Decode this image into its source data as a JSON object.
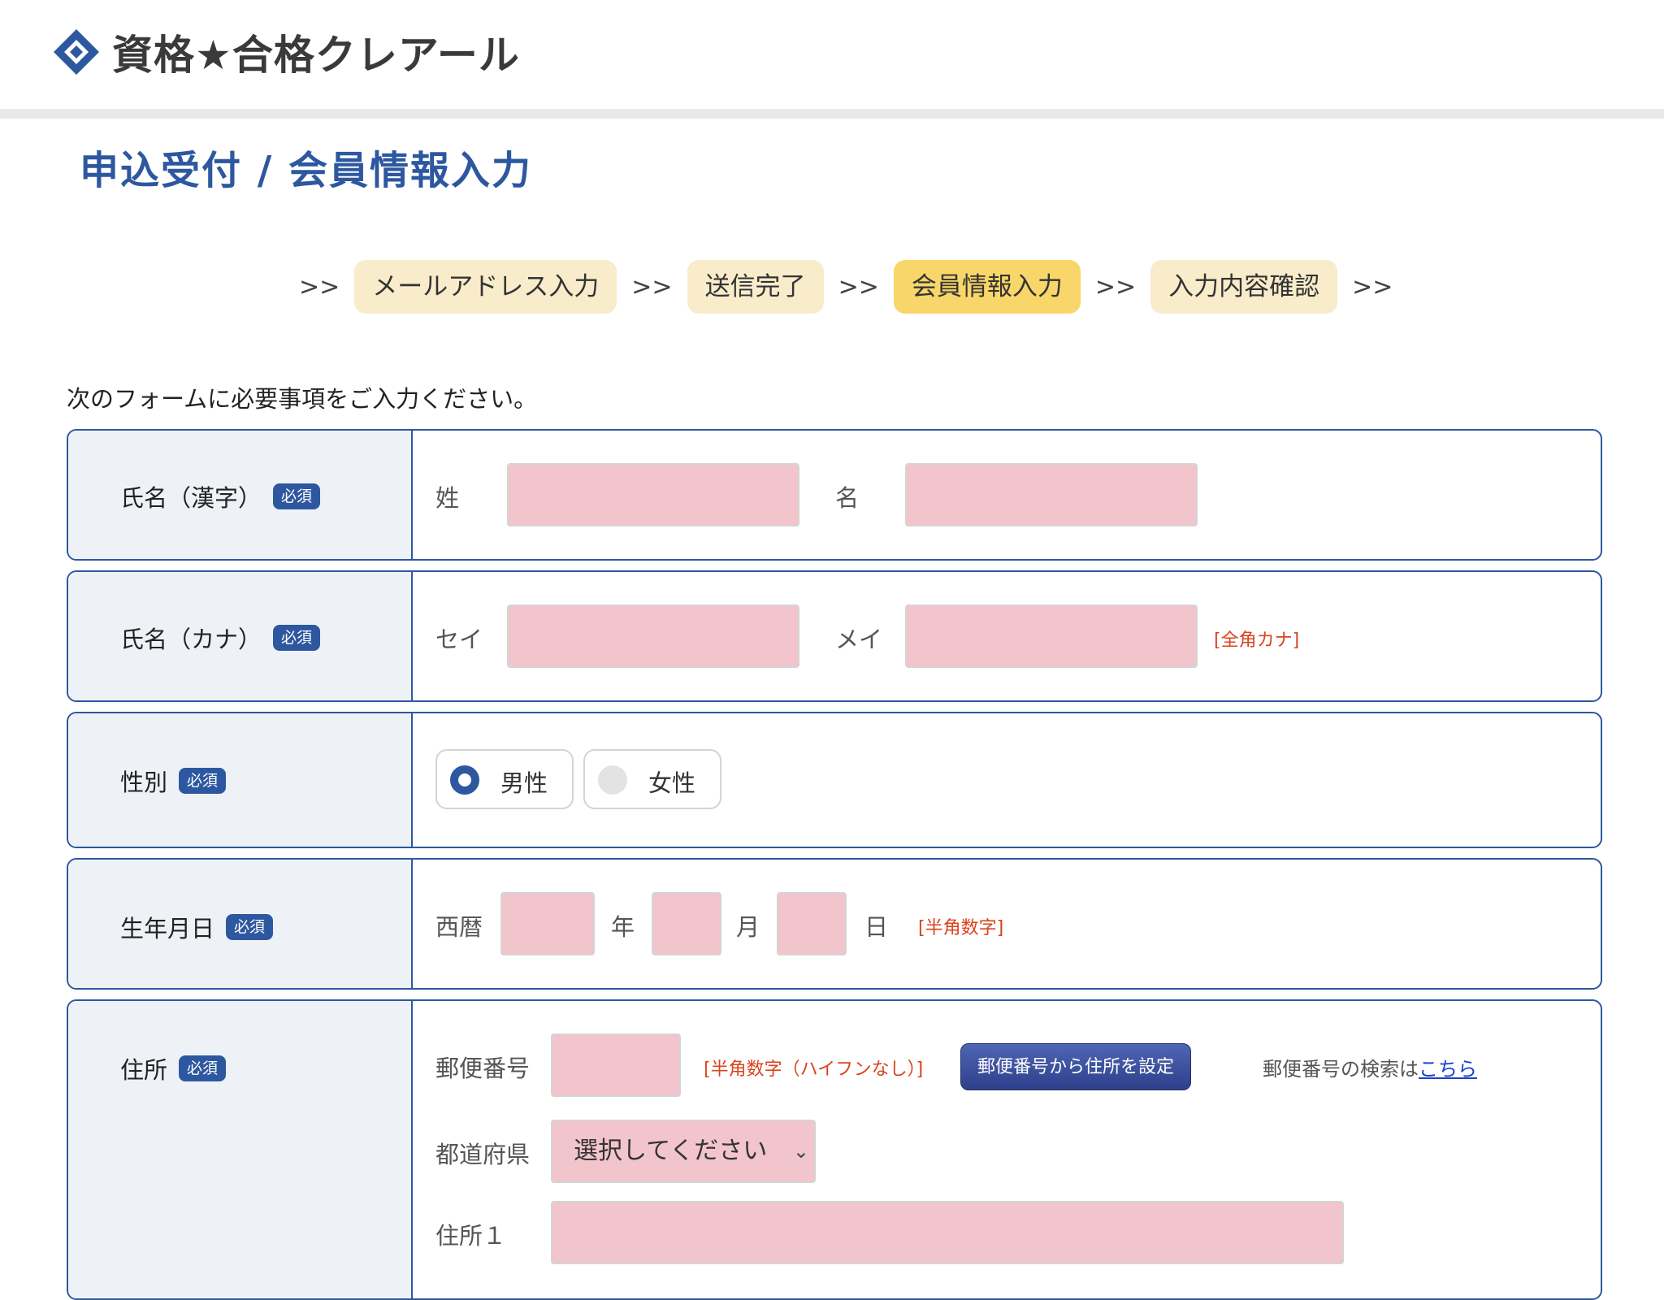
{
  "brand": {
    "logo_text": "資格★合格クレアール",
    "accent": "#2d58a0"
  },
  "page_title": "申込受付 / 会員情報入力",
  "steps": {
    "sep": ">>",
    "items": [
      "メールアドレス入力",
      "送信完了",
      "会員情報入力",
      "入力内容確認"
    ],
    "active_index": 2
  },
  "lead": "次のフォームに必要事項をご入力ください。",
  "required_badge": "必須",
  "name_kanji": {
    "label": "氏名（漢字）",
    "sei_label": "姓",
    "mei_label": "名"
  },
  "name_kana": {
    "label": "氏名（カナ）",
    "sei_label": "セイ",
    "mei_label": "メイ",
    "note": "[全角カナ]"
  },
  "gender": {
    "label": "性別",
    "options": [
      "男性",
      "女性"
    ],
    "selected": "男性"
  },
  "birthday": {
    "label": "生年月日",
    "era_label": "西暦",
    "year_label": "年",
    "month_label": "月",
    "day_label": "日",
    "note": "[半角数字]"
  },
  "address": {
    "label": "住所",
    "zip_label": "郵便番号",
    "zip_note": "[半角数字（ハイフンなし）]",
    "zip_button": "郵便番号から住所を設定",
    "zip_search_text": "郵便番号の検索は",
    "zip_search_link": "こちら",
    "pref_label": "都道府県",
    "pref_value": "選択してください",
    "addr1_label": "住所１"
  }
}
